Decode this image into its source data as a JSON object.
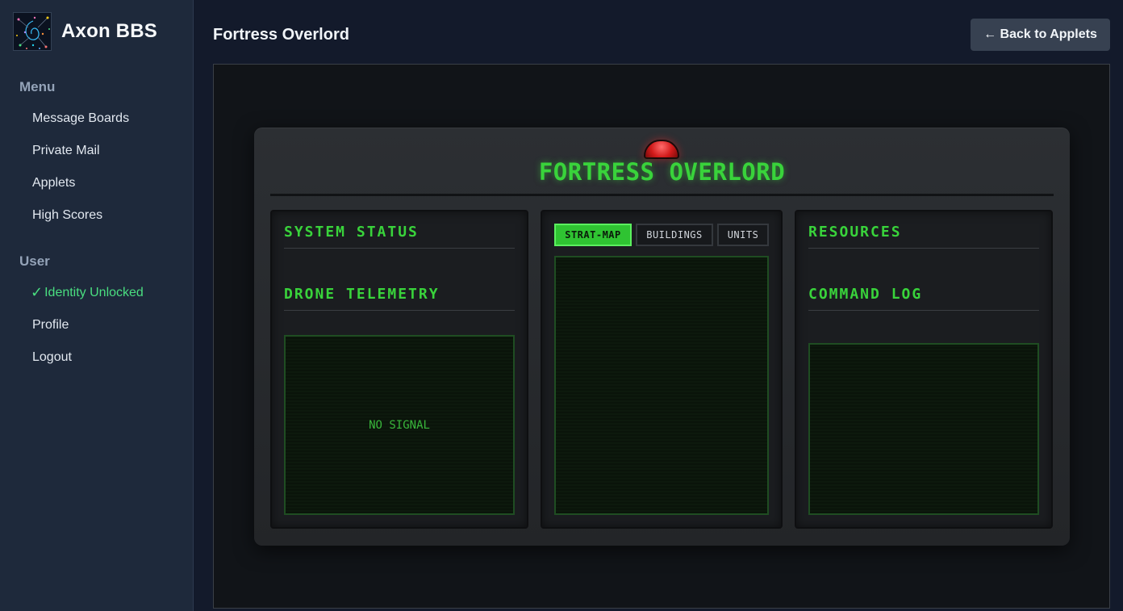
{
  "app": {
    "name": "Axon BBS"
  },
  "sidebar": {
    "menu_heading": "Menu",
    "menu_items": [
      {
        "label": "Message Boards"
      },
      {
        "label": "Private Mail"
      },
      {
        "label": "Applets"
      },
      {
        "label": "High Scores"
      }
    ],
    "user_heading": "User",
    "identity_check": "✓",
    "identity_label": "Identity Unlocked",
    "user_items": [
      {
        "label": "Profile"
      },
      {
        "label": "Logout"
      }
    ]
  },
  "header": {
    "title": "Fortress Overlord",
    "back_label": "← Back to Applets"
  },
  "game": {
    "title": "FORTRESS OVERLORD",
    "system_status": "SYSTEM STATUS",
    "drone_telemetry": "DRONE TELEMETRY",
    "no_signal": "NO SIGNAL",
    "tabs": [
      {
        "label": "STRAT-MAP",
        "active": true
      },
      {
        "label": "BUILDINGS",
        "active": false
      },
      {
        "label": "UNITS",
        "active": false
      }
    ],
    "resources": "RESOURCES",
    "command_log": "COMMAND LOG"
  },
  "colors": {
    "sidebar_bg": "#1e293b",
    "page_bg": "#131a2b",
    "terminal_green": "#39d33b",
    "identity_green": "#4ade80",
    "alarm_red": "#d11a1a"
  }
}
